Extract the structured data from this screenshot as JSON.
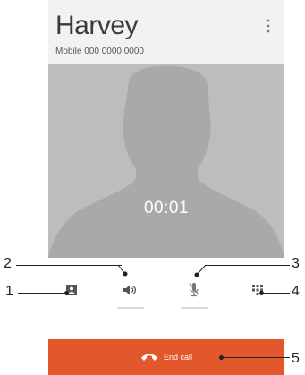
{
  "contact": {
    "name": "Harvey",
    "number": "Mobile 000 0000 0000"
  },
  "call": {
    "timer": "00:01",
    "end_label": "End call"
  },
  "icons": {
    "overflow": "more-vert-icon",
    "contacts": "contacts-icon",
    "speaker": "speaker-icon",
    "mute": "mute-mic-icon",
    "dialpad": "dialpad-icon",
    "end_call": "end-call-icon"
  },
  "callouts": {
    "c1": "1",
    "c2": "2",
    "c3": "3",
    "c4": "4",
    "c5": "5"
  },
  "colors": {
    "end_call_bg": "#e2582c",
    "photo_bg": "#bdbdbd",
    "header_bg": "#f2f2f2"
  }
}
